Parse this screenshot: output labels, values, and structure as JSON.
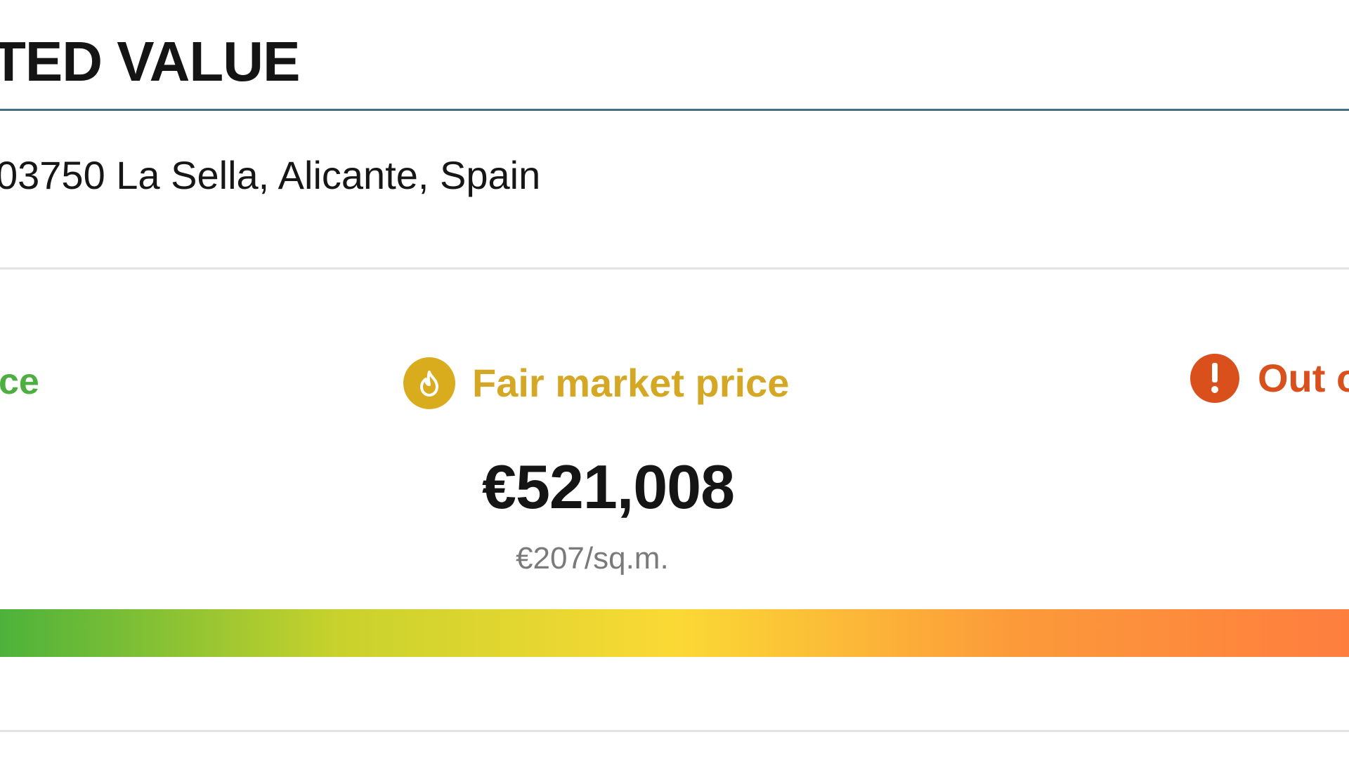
{
  "header": {
    "title": "TED VALUE"
  },
  "property": {
    "address": "03750 La Sella, Alicante, Spain"
  },
  "price_scale": {
    "low_label": "ce",
    "fair_label": "Fair market price",
    "high_label": "Out o",
    "fair_icon": "flame-icon",
    "high_icon": "exclamation-icon"
  },
  "valuation": {
    "price": "€521,008",
    "price_per_sqm": "€207/sq.m."
  },
  "colors": {
    "header_rule": "#476f84",
    "low": "#4caf3f",
    "fair": "#d4a825",
    "fair_icon_bg": "#d9ac1e",
    "high": "#d9501c",
    "high_icon_bg": "#d9501c",
    "gradient": [
      "#4cb23b",
      "#c8d22c",
      "#fbd935",
      "#fc9a3a",
      "#fe7e3e"
    ]
  }
}
